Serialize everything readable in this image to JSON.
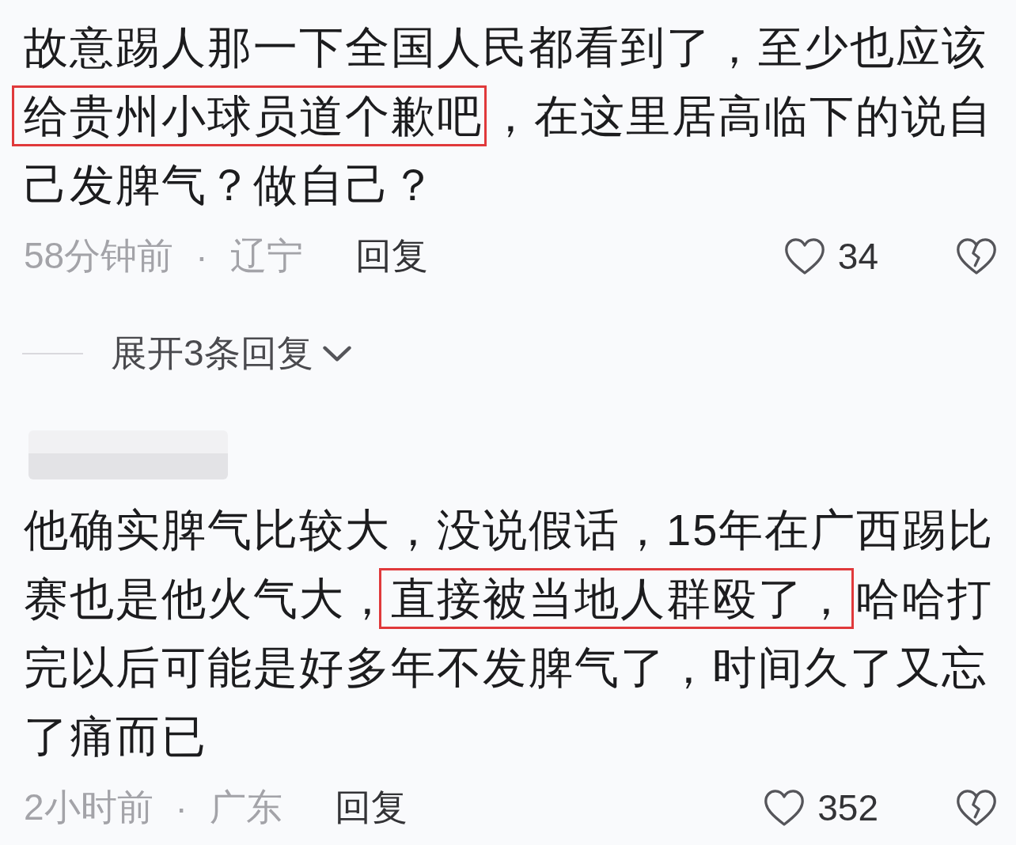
{
  "comments": [
    {
      "text_segments": [
        {
          "text": "故意踢人那一下全国人民都看到了，至少也应该",
          "highlighted": false
        },
        {
          "text": "给贵州小球员道个歉吧",
          "highlighted": true
        },
        {
          "text": "，在这里居高临下的说自己发脾气？做自己？",
          "highlighted": false
        }
      ],
      "time": "58分钟前",
      "separator": "·",
      "location": "辽宁",
      "reply_label": "回复",
      "like_count": "34",
      "expand_replies": "展开3条回复"
    },
    {
      "author_hidden": true,
      "text_segments": [
        {
          "text": "他确实脾气比较大，没说假话，15年在广西踢比赛也是他火气大，",
          "highlighted": false
        },
        {
          "text": "直接被当地人群殴了，",
          "highlighted": true
        },
        {
          "text": "哈哈打完以后可能是好多年不发脾气了，时间久了又忘了痛而已",
          "highlighted": false
        }
      ],
      "time": "2小时前",
      "separator": "·",
      "location": "广东",
      "reply_label": "回复",
      "like_count": "352"
    }
  ]
}
